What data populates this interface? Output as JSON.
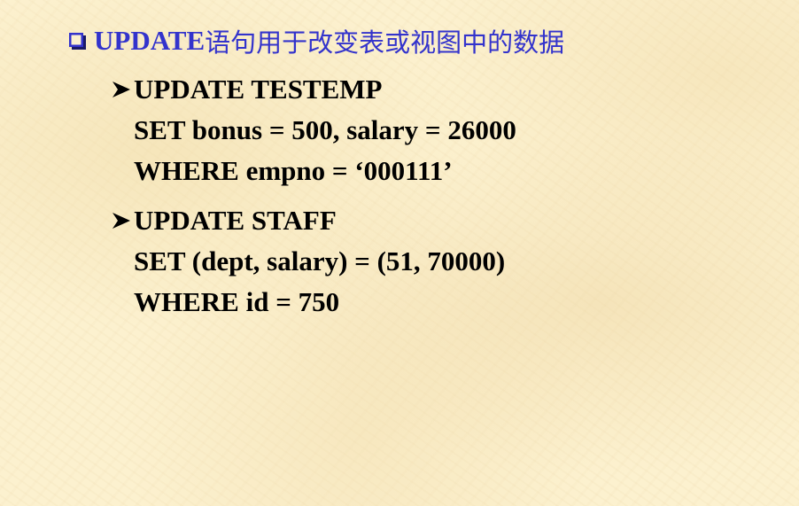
{
  "heading": {
    "bullet_icon": "hollow-square-icon",
    "keyword": "UPDATE",
    "description": "语句用于改变表或视图中的数据",
    "color": "#3333cc"
  },
  "examples": [
    {
      "bullet_icon": "arrowhead-icon",
      "line1": "UPDATE TESTEMP",
      "line2": "SET bonus = 500, salary = 26000",
      "line3": "WHERE empno = ‘000111’"
    },
    {
      "bullet_icon": "arrowhead-icon",
      "line1": "UPDATE STAFF",
      "line2": "SET (dept, salary) = (51, 70000)",
      "line3": "WHERE id = 750"
    }
  ],
  "background_color": "#fcf1cf"
}
